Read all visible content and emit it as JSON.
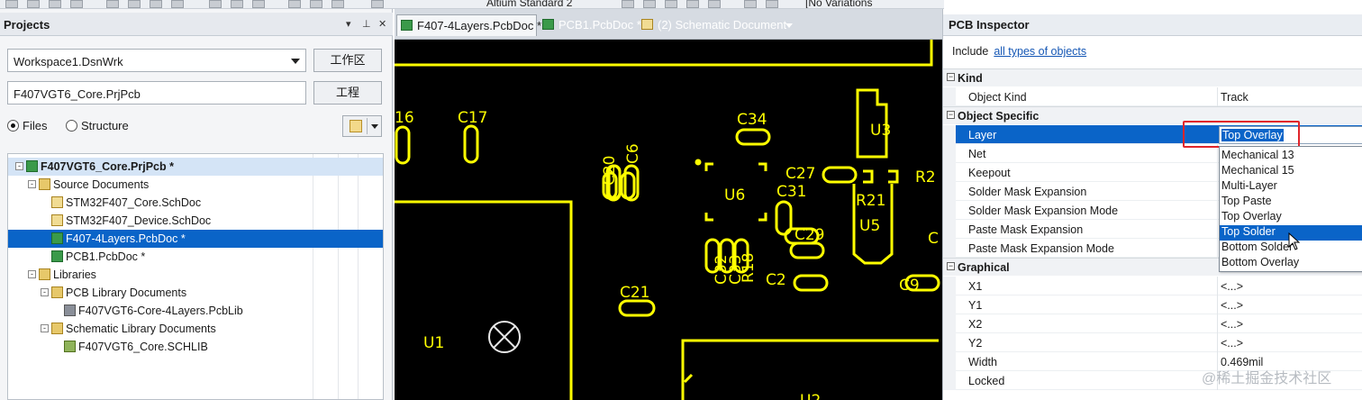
{
  "toolbar": {
    "variant_partial": "Altium Standard 2",
    "variations_partial": "[No Variations"
  },
  "projects": {
    "title": "Projects",
    "workspace": "Workspace1.DsnWrk",
    "workspace_btn": "工作区",
    "project": "F407VGT6_Core.PrjPcb",
    "project_btn": "工程",
    "view_files": "Files",
    "view_structure": "Structure",
    "tree": [
      {
        "label": "F407VGT6_Core.PrjPcb *",
        "exp": "-"
      },
      {
        "label": "Source Documents",
        "exp": "-"
      },
      {
        "label": "STM32F407_Core.SchDoc"
      },
      {
        "label": "STM32F407_Device.SchDoc"
      },
      {
        "label": "F407-4Layers.PcbDoc *"
      },
      {
        "label": "PCB1.PcbDoc *"
      },
      {
        "label": "Libraries",
        "exp": "-"
      },
      {
        "label": "PCB Library Documents",
        "exp": "-"
      },
      {
        "label": "F407VGT6-Core-4Layers.PcbLib"
      },
      {
        "label": "Schematic Library Documents",
        "exp": "-"
      },
      {
        "label": "F407VGT6_Core.SCHLIB"
      }
    ]
  },
  "tabs": [
    {
      "label": "F407-4Layers.PcbDoc *"
    },
    {
      "label": "PCB1.PcbDoc *"
    },
    {
      "label": "(2) Schematic Document"
    }
  ],
  "pcb": {
    "labels": [
      "16",
      "C17",
      "C6",
      "C20",
      "C34",
      "U3",
      "U6",
      "C27",
      "C31",
      "R21",
      "U5",
      "R2",
      "C29",
      "C2",
      "C9",
      "C",
      "C21",
      "C32",
      "C33",
      "R18",
      "U1",
      "U2"
    ]
  },
  "inspector": {
    "title": "PCB Inspector",
    "include_label": "Include",
    "include_link": "all types of objects",
    "sections": {
      "kind": "Kind",
      "object_specific": "Object Specific",
      "graphical": "Graphical"
    },
    "kind_rows": [
      {
        "name": "Object Kind",
        "value": "Track"
      }
    ],
    "specific_rows": [
      {
        "name": "Layer",
        "value": "Top Overlay"
      },
      {
        "name": "Net",
        "value": ""
      },
      {
        "name": "Keepout",
        "value": ""
      },
      {
        "name": "Solder Mask Expansion",
        "value": ""
      },
      {
        "name": "Solder Mask Expansion Mode",
        "value": ""
      },
      {
        "name": "Paste Mask Expansion",
        "value": ""
      },
      {
        "name": "Paste Mask Expansion Mode",
        "value": ""
      }
    ],
    "graphical_rows": [
      {
        "name": "X1",
        "value": "<...>"
      },
      {
        "name": "Y1",
        "value": "<...>"
      },
      {
        "name": "X2",
        "value": "<...>"
      },
      {
        "name": "Y2",
        "value": "<...>"
      },
      {
        "name": "Width",
        "value": "0.469mil"
      },
      {
        "name": "Locked",
        "value": ""
      }
    ],
    "layer_options": [
      "Mechanical 13",
      "Mechanical 15",
      "Multi-Layer",
      "Top Paste",
      "Top Overlay",
      "Top Solder",
      "Bottom Solder",
      "Bottom Overlay"
    ],
    "layer_selected": "Top Solder"
  },
  "watermark": "@稀土掘金技术社区"
}
